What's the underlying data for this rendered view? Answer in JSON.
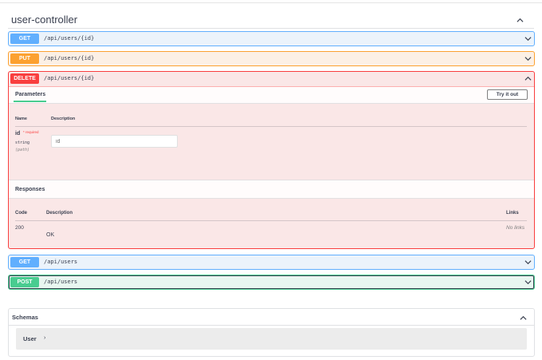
{
  "tag": {
    "title": "user-controller"
  },
  "operations": [
    {
      "method": "GET",
      "path": "/api/users/{id}"
    },
    {
      "method": "PUT",
      "path": "/api/users/{id}"
    },
    {
      "method": "DELETE",
      "path": "/api/users/{id}"
    },
    {
      "method": "GET",
      "path": "/api/users"
    },
    {
      "method": "POST",
      "path": "/api/users"
    }
  ],
  "expanded": {
    "parameters_tab": "Parameters",
    "try_button": "Try it out",
    "param_headers": {
      "name": "Name",
      "description": "Description"
    },
    "param": {
      "name": "id",
      "required": "* required",
      "type": "string",
      "in": "(path)",
      "placeholder": "id"
    },
    "responses_title": "Responses",
    "response_headers": {
      "code": "Code",
      "description": "Description",
      "links": "Links"
    },
    "response": {
      "code": "200",
      "description": "OK",
      "links": "No links"
    }
  },
  "schemas": {
    "title": "Schemas",
    "models": [
      {
        "name": "User",
        "arrow": "›"
      }
    ]
  },
  "colors": {
    "get": "#61affe",
    "put": "#fca130",
    "delete": "#f93e3e",
    "post": "#49cc90"
  },
  "icons": {
    "collapse": "chevron-up-icon",
    "expand": "chevron-down-icon"
  }
}
